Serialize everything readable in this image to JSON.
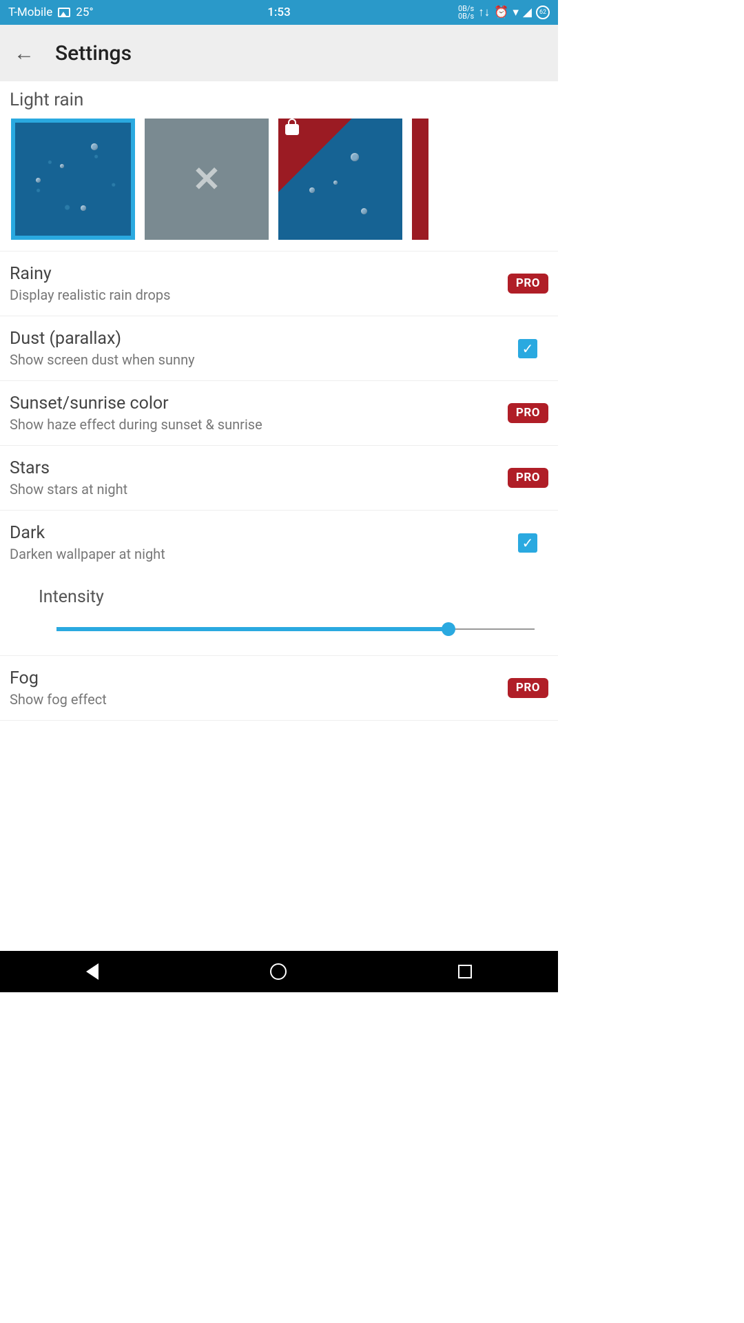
{
  "status": {
    "carrier": "T-Mobile",
    "temp": "25°",
    "time": "1:53",
    "speed_up": "0B/s",
    "speed_down": "0B/s",
    "battery": "62"
  },
  "header": {
    "title": "Settings"
  },
  "section": {
    "title": "Light rain"
  },
  "settings": {
    "rainy": {
      "title": "Rainy",
      "sub": "Display realistic rain drops",
      "badge": "PRO"
    },
    "dust": {
      "title": "Dust (parallax)",
      "sub": "Show screen dust when sunny"
    },
    "sun": {
      "title": "Sunset/sunrise color",
      "sub": "Show haze effect during sunset & sunrise",
      "badge": "PRO"
    },
    "stars": {
      "title": "Stars",
      "sub": "Show stars at night",
      "badge": "PRO"
    },
    "dark": {
      "title": "Dark",
      "sub": "Darken wallpaper at night"
    },
    "intensity": {
      "label": "Intensity"
    },
    "fog": {
      "title": "Fog",
      "sub": "Show fog effect",
      "badge": "PRO"
    }
  }
}
